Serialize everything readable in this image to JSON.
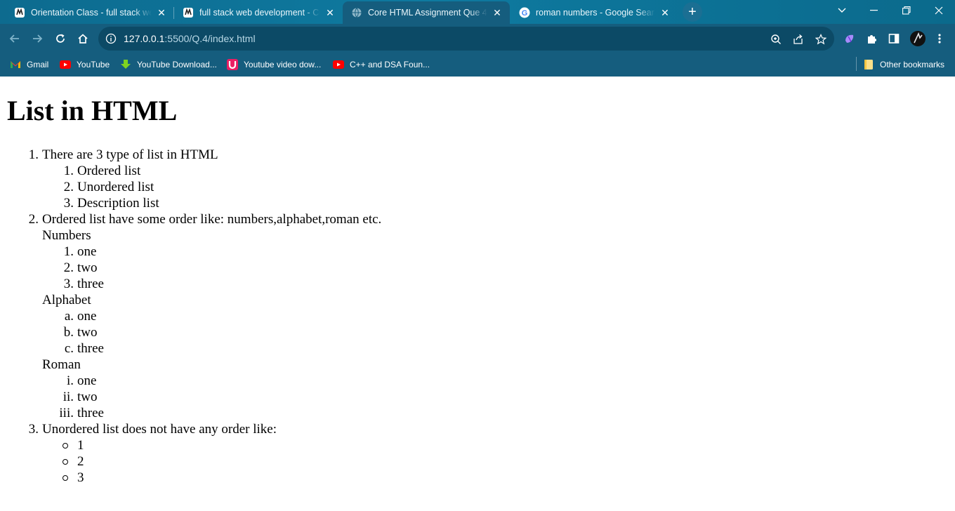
{
  "browser": {
    "tabs": [
      {
        "title": "Orientation Class - full stack web"
      },
      {
        "title": "full stack web development - Cou"
      },
      {
        "title": "Core HTML Assignment Que 4"
      },
      {
        "title": "roman numbers - Google Search"
      }
    ],
    "url_host": "127.0.0.1",
    "url_path": ":5500/Q.4/index.html",
    "bookmarks": [
      {
        "label": "Gmail"
      },
      {
        "label": "YouTube"
      },
      {
        "label": "YouTube Download..."
      },
      {
        "label": "Youtube video dow..."
      },
      {
        "label": "C++ and DSA Foun..."
      }
    ],
    "other_bookmarks": "Other bookmarks",
    "colors": {
      "chrome": "#155d7e",
      "omnibox": "#0c4a66",
      "tabstrip": "#0e7aa0"
    }
  },
  "page": {
    "heading": "List in HTML",
    "items": [
      {
        "marker": "1.",
        "text": "There are 3 type of list in HTML"
      },
      {
        "marker": "1.",
        "text": "Ordered list"
      },
      {
        "marker": "2.",
        "text": "Unordered list"
      },
      {
        "marker": "3.",
        "text": "Description list"
      },
      {
        "marker": "2.",
        "text": "Ordered list have some order like: numbers,alphabet,roman etc."
      },
      {
        "marker": "",
        "text": "Numbers"
      },
      {
        "marker": "1.",
        "text": "one"
      },
      {
        "marker": "2.",
        "text": "two"
      },
      {
        "marker": "3.",
        "text": "three"
      },
      {
        "marker": "",
        "text": "Alphabet"
      },
      {
        "marker": "a.",
        "text": "one"
      },
      {
        "marker": "b.",
        "text": "two"
      },
      {
        "marker": "c.",
        "text": "three"
      },
      {
        "marker": "",
        "text": "Roman"
      },
      {
        "marker": "i.",
        "text": "one"
      },
      {
        "marker": "ii.",
        "text": "two"
      },
      {
        "marker": "iii.",
        "text": "three"
      },
      {
        "marker": "3.",
        "text": "Unordered list does not have any order like:"
      },
      {
        "marker": "",
        "text": "1"
      },
      {
        "marker": "",
        "text": "2"
      },
      {
        "marker": "",
        "text": "3"
      }
    ]
  }
}
